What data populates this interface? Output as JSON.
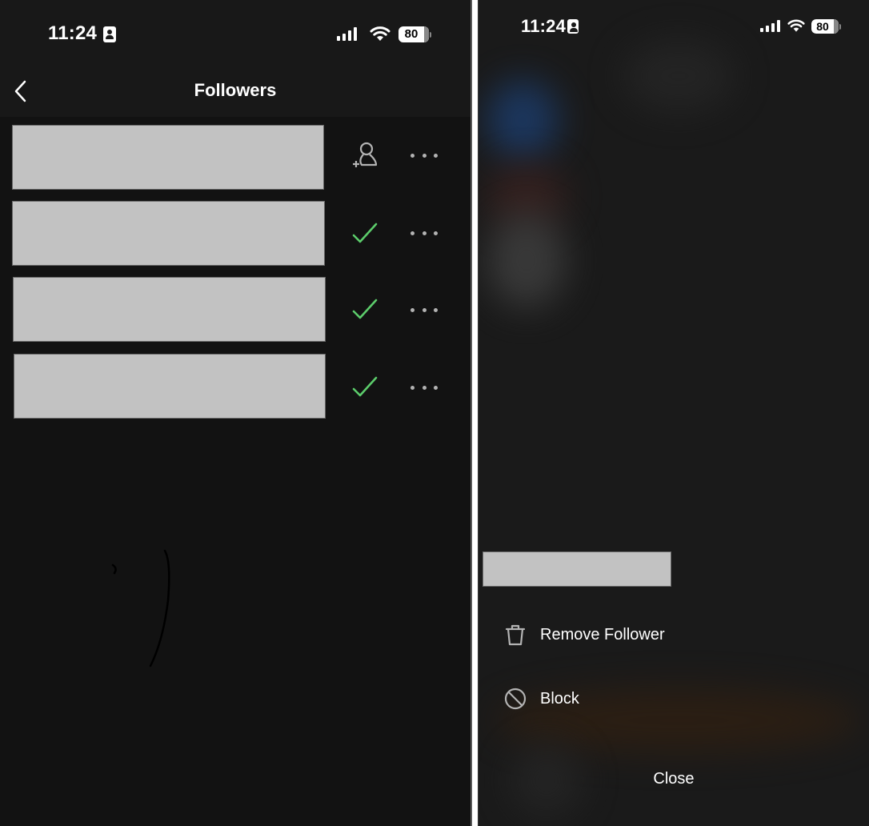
{
  "left_screen": {
    "status_bar": {
      "time": "11:24",
      "battery": "80",
      "icons": [
        "contact-badge-icon",
        "cellular-signal-icon",
        "wifi-icon",
        "battery-icon"
      ]
    },
    "header": {
      "back_icon": "chevron-left-icon",
      "title": "Followers"
    },
    "followers": [
      {
        "name": "[redacted]",
        "follow_state": "not-following",
        "status_icon": "add-person-icon",
        "more_icon": "more-horizontal-icon"
      },
      {
        "name": "[redacted]",
        "follow_state": "following",
        "status_icon": "check-icon",
        "more_icon": "more-horizontal-icon"
      },
      {
        "name": "[redacted]",
        "follow_state": "following",
        "status_icon": "check-icon",
        "more_icon": "more-horizontal-icon"
      },
      {
        "name": "[redacted]",
        "follow_state": "following",
        "status_icon": "check-icon",
        "more_icon": "more-horizontal-icon"
      }
    ],
    "colors": {
      "header_bg": "#181818",
      "list_bg": "#121212",
      "following_check": "#5ccc6b",
      "icon_gray": "#b3b3b3",
      "redaction": "#c2c2c2"
    }
  },
  "right_screen": {
    "status_bar": {
      "time": "11:24",
      "battery": "80"
    },
    "action_sheet": {
      "user_name": "[redacted]",
      "items": [
        {
          "label": "Remove Follower",
          "icon": "trash-icon"
        },
        {
          "label": "Block",
          "icon": "block-icon"
        }
      ],
      "close_label": "Close"
    },
    "colors": {
      "backdrop": "#1a1a1a",
      "text": "#ffffff"
    }
  }
}
